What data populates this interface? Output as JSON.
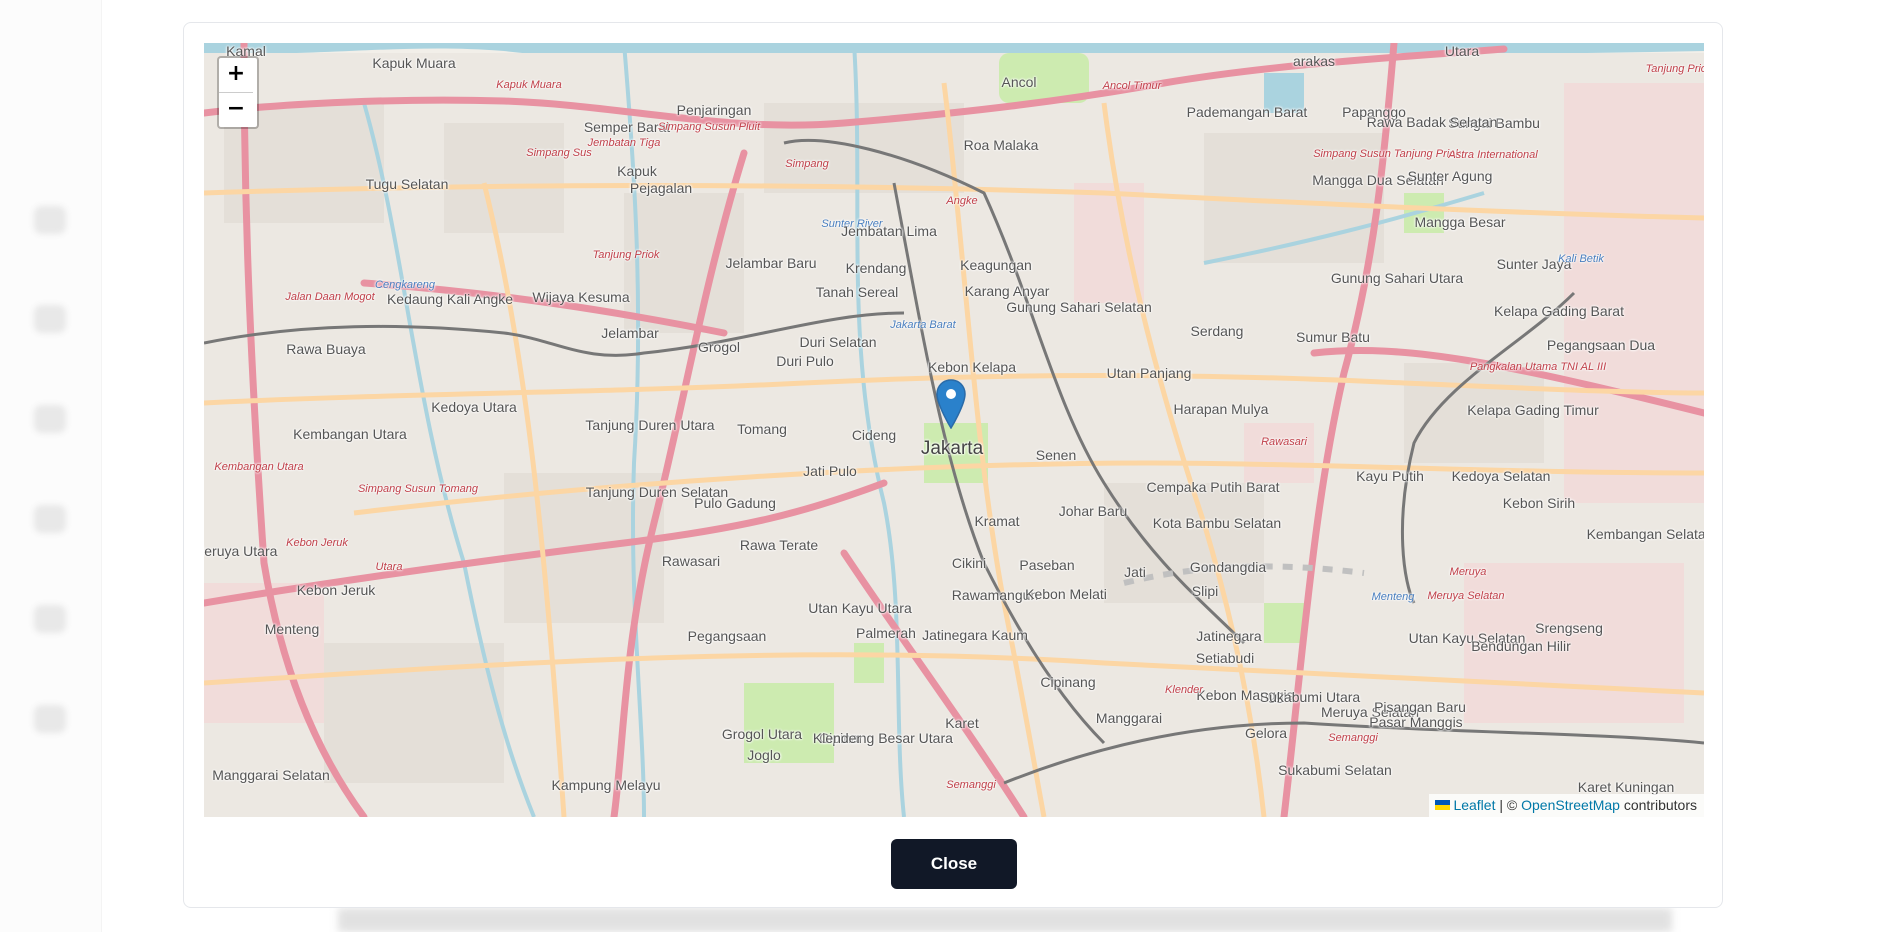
{
  "map": {
    "zoom_in_label": "+",
    "zoom_out_label": "−",
    "marker_icon": "map-pin-icon",
    "marker_color": "#2a81cb",
    "attribution": {
      "leaflet_label": "Leaflet",
      "separator": " | © ",
      "osm_label": "OpenStreetMap",
      "suffix": " contributors"
    },
    "places": [
      {
        "label": "Kamal",
        "kind": "place"
      },
      {
        "label": "Kapuk Muara",
        "kind": "place"
      },
      {
        "label": "Kapuk Muara",
        "kind": "road"
      },
      {
        "label": "Penjaringan",
        "kind": "place"
      },
      {
        "label": "Ancol",
        "kind": "place"
      },
      {
        "label": "Ancol Timur",
        "kind": "road"
      },
      {
        "label": "arakas",
        "kind": "place"
      },
      {
        "label": "Utara",
        "kind": "place"
      },
      {
        "label": "Tanjung Priok",
        "kind": "road"
      },
      {
        "label": "Semper Barat",
        "kind": "place"
      },
      {
        "label": "Simpang Susun Pluit",
        "kind": "road"
      },
      {
        "label": "Jembatan Tiga",
        "kind": "road"
      },
      {
        "label": "Simpang",
        "kind": "road"
      },
      {
        "label": "Roa Malaka",
        "kind": "place"
      },
      {
        "label": "Pademangan Barat",
        "kind": "place"
      },
      {
        "label": "Papanggo",
        "kind": "place"
      },
      {
        "label": "Sungai Bambu",
        "kind": "place"
      },
      {
        "label": "Rawa Badak Selatan",
        "kind": "place"
      },
      {
        "label": "Simpang Susun Tanjung Priok",
        "kind": "road"
      },
      {
        "label": "Simpang Sus",
        "kind": "road"
      },
      {
        "label": "Astra International",
        "kind": "road"
      },
      {
        "label": "Tugu Selatan",
        "kind": "place"
      },
      {
        "label": "Kapuk",
        "kind": "place"
      },
      {
        "label": "Pejagalan",
        "kind": "place"
      },
      {
        "label": "Angke",
        "kind": "road"
      },
      {
        "label": "Mangga Dua Selatan",
        "kind": "place"
      },
      {
        "label": "Sunter Agung",
        "kind": "place"
      },
      {
        "label": "Sunter River",
        "kind": "water"
      },
      {
        "label": "Jembatan Lima",
        "kind": "place"
      },
      {
        "label": "Mangga Besar",
        "kind": "place"
      },
      {
        "label": "Tanjung Priok",
        "kind": "road"
      },
      {
        "label": "Jelambar Baru",
        "kind": "place"
      },
      {
        "label": "Krendang",
        "kind": "place"
      },
      {
        "label": "Keagungan",
        "kind": "place"
      },
      {
        "label": "Gunung Sahari Utara",
        "kind": "place"
      },
      {
        "label": "Sunter Jaya",
        "kind": "place"
      },
      {
        "label": "Kali Betik",
        "kind": "water"
      },
      {
        "label": "Kedaung Kali Angke",
        "kind": "place"
      },
      {
        "label": "Cengkareng",
        "kind": "water"
      },
      {
        "label": "Jalan Daan Mogot",
        "kind": "road"
      },
      {
        "label": "Wijaya Kesuma",
        "kind": "place"
      },
      {
        "label": "Tanah Sereal",
        "kind": "place"
      },
      {
        "label": "Karang Anyar",
        "kind": "place"
      },
      {
        "label": "Gunung Sahari Selatan",
        "kind": "place"
      },
      {
        "label": "Kelapa Gading Barat",
        "kind": "place"
      },
      {
        "label": "Jelambar",
        "kind": "place"
      },
      {
        "label": "Grogol",
        "kind": "place"
      },
      {
        "label": "Duri Selatan",
        "kind": "place"
      },
      {
        "label": "Jakarta Barat",
        "kind": "water"
      },
      {
        "label": "Serdang",
        "kind": "place"
      },
      {
        "label": "Sumur Batu",
        "kind": "place"
      },
      {
        "label": "Pangkalan Utama TNI AL III",
        "kind": "road"
      },
      {
        "label": "Pegangsaan Dua",
        "kind": "place"
      },
      {
        "label": "Rawa Buaya",
        "kind": "place"
      },
      {
        "label": "Duri Pulo",
        "kind": "place"
      },
      {
        "label": "Kebon Kelapa",
        "kind": "place"
      },
      {
        "label": "Utan Panjang",
        "kind": "place"
      },
      {
        "label": "Kedoya Utara",
        "kind": "place"
      },
      {
        "label": "Tanjung Duren Utara",
        "kind": "place"
      },
      {
        "label": "Harapan Mulya",
        "kind": "place"
      },
      {
        "label": "Kelapa Gading Timur",
        "kind": "place"
      },
      {
        "label": "Kembangan Utara",
        "kind": "place"
      },
      {
        "label": "Tomang",
        "kind": "place"
      },
      {
        "label": "Cideng",
        "kind": "place"
      },
      {
        "label": "Jakarta",
        "kind": "city"
      },
      {
        "label": "Senen",
        "kind": "place"
      },
      {
        "label": "Rawasari",
        "kind": "road"
      },
      {
        "label": "Kembangan Utara",
        "kind": "road"
      },
      {
        "label": "Jati Pulo",
        "kind": "place"
      },
      {
        "label": "Tanjung Duren Selatan",
        "kind": "place"
      },
      {
        "label": "Cempaka Putih Barat",
        "kind": "place"
      },
      {
        "label": "Kayu Putih",
        "kind": "place"
      },
      {
        "label": "Kedoya Selatan",
        "kind": "place"
      },
      {
        "label": "Simpang Susun Tomang",
        "kind": "road"
      },
      {
        "label": "Pulo Gadung",
        "kind": "place"
      },
      {
        "label": "Kebon Sirih",
        "kind": "place"
      },
      {
        "label": "Kramat",
        "kind": "place"
      },
      {
        "label": "Johar Baru",
        "kind": "place"
      },
      {
        "label": "Kota Bambu Selatan",
        "kind": "place"
      },
      {
        "label": "Rawa Terate",
        "kind": "place"
      },
      {
        "label": "Kembangan Selatan",
        "kind": "place"
      },
      {
        "label": "Kebon Jeruk",
        "kind": "road"
      },
      {
        "label": "Rawasari",
        "kind": "place"
      },
      {
        "label": "Gondangdia",
        "kind": "place"
      },
      {
        "label": "Cikini",
        "kind": "place"
      },
      {
        "label": "Paseban",
        "kind": "place"
      },
      {
        "label": "Jati",
        "kind": "place"
      },
      {
        "label": "Meruya",
        "kind": "road"
      },
      {
        "label": "Utara",
        "kind": "road"
      },
      {
        "label": "Meruya Utara",
        "kind": "place"
      },
      {
        "label": "Kebon Jeruk",
        "kind": "place"
      },
      {
        "label": "Slipi",
        "kind": "place"
      },
      {
        "label": "Menteng",
        "kind": "water"
      },
      {
        "label": "Utan Kayu Utara",
        "kind": "place"
      },
      {
        "label": "Rawamangun",
        "kind": "place"
      },
      {
        "label": "Kebon Melati",
        "kind": "place"
      },
      {
        "label": "Meruya Selatan",
        "kind": "road"
      },
      {
        "label": "Palmerah",
        "kind": "place"
      },
      {
        "label": "Menteng",
        "kind": "place"
      },
      {
        "label": "Pegangsaan",
        "kind": "place"
      },
      {
        "label": "Jatinegara Kaum",
        "kind": "place"
      },
      {
        "label": "Jatinegara",
        "kind": "place"
      },
      {
        "label": "Utan Kayu Selatan",
        "kind": "place"
      },
      {
        "label": "Srengseng",
        "kind": "place"
      },
      {
        "label": "Bendungan Hilir",
        "kind": "place"
      },
      {
        "label": "Setiabudi",
        "kind": "place"
      },
      {
        "label": "Kebon Manggis",
        "kind": "place"
      },
      {
        "label": "Cipinang",
        "kind": "place"
      },
      {
        "label": "Sukabumi Utara",
        "kind": "place"
      },
      {
        "label": "Klender",
        "kind": "road"
      },
      {
        "label": "Meruya Selatan",
        "kind": "place"
      },
      {
        "label": "Pasar Manggis",
        "kind": "place"
      },
      {
        "label": "Pisangan Baru",
        "kind": "place"
      },
      {
        "label": "Manggarai",
        "kind": "place"
      },
      {
        "label": "Karet",
        "kind": "place"
      },
      {
        "label": "Gelora",
        "kind": "place"
      },
      {
        "label": "Semanggi",
        "kind": "road"
      },
      {
        "label": "Grogol Utara",
        "kind": "place"
      },
      {
        "label": "Cipinang Besar Utara",
        "kind": "place"
      },
      {
        "label": "Klender",
        "kind": "place"
      },
      {
        "label": "Joglo",
        "kind": "place"
      },
      {
        "label": "Sukabumi Selatan",
        "kind": "place"
      },
      {
        "label": "Karet Kuningan",
        "kind": "place"
      },
      {
        "label": "Manggarai Selatan",
        "kind": "place"
      },
      {
        "label": "Kampung Melayu",
        "kind": "place"
      },
      {
        "label": "Semanggi",
        "kind": "road"
      }
    ]
  },
  "modal": {
    "close_label": "Close"
  },
  "background": {
    "sidebar_icons": [
      "home-icon",
      "clock-icon",
      "gear-icon",
      "document-icon",
      "send-icon",
      "logout-icon"
    ]
  }
}
